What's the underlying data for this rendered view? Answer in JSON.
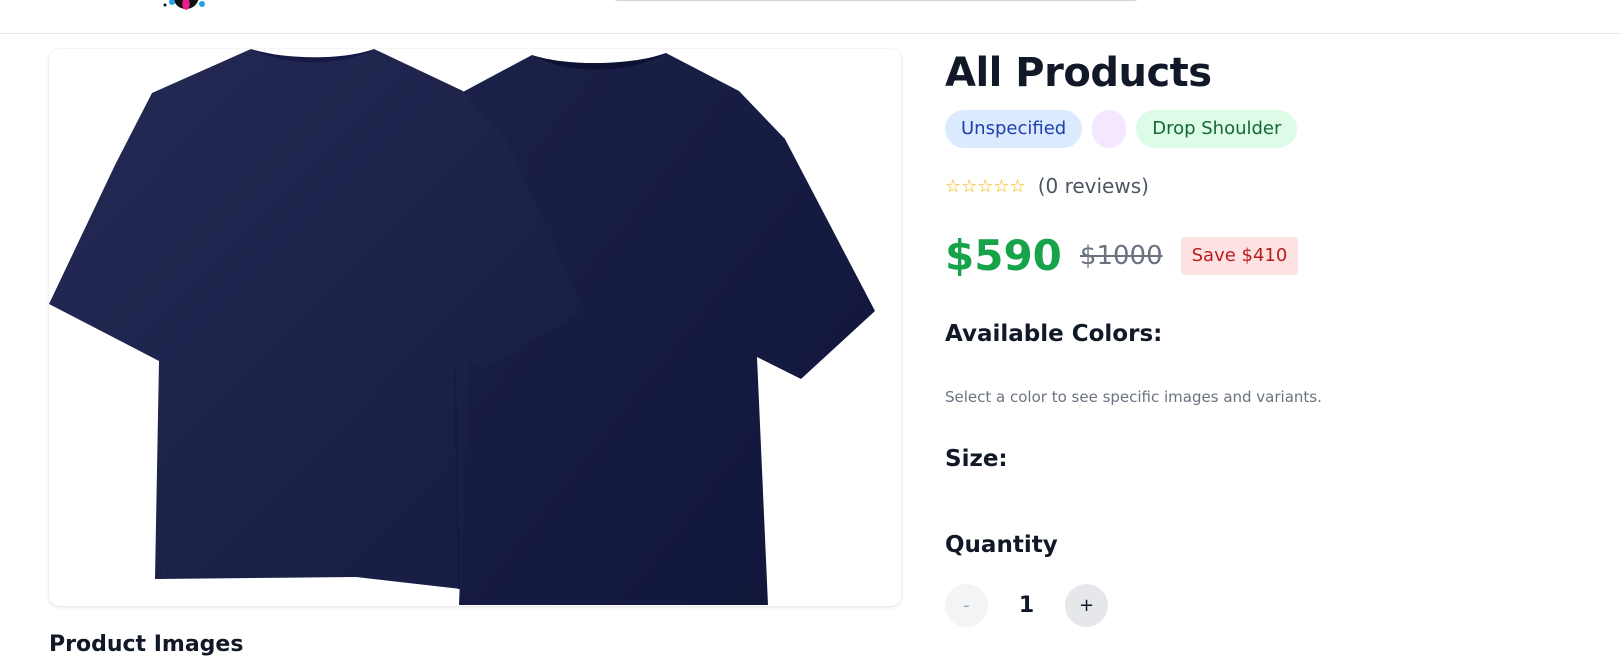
{
  "header": {
    "logo": "brand-logo",
    "search": "search-bar"
  },
  "gallery": {
    "main_image": "navy-tshirt-front-back",
    "thumbnails_title": "Product Images"
  },
  "product": {
    "title": "All Products",
    "tags": [
      "Unspecified",
      "",
      "Drop Shoulder"
    ],
    "rating": {
      "stars": "☆☆☆☆☆",
      "reviews_text": "(0 reviews)"
    },
    "price": "$590",
    "original_price": "$1000",
    "savings": "Save $410",
    "colors_label": "Available Colors:",
    "colors_hint": "Select a color to see specific images and variants.",
    "size_label": "Size:",
    "quantity_label": "Quantity",
    "quantity": {
      "decrement": "-",
      "value": "1",
      "increment": "+"
    }
  },
  "colors": {
    "price_green": "#16a34a",
    "save_red": "#b91c1c",
    "shirt_navy": "#1a1f4a"
  }
}
